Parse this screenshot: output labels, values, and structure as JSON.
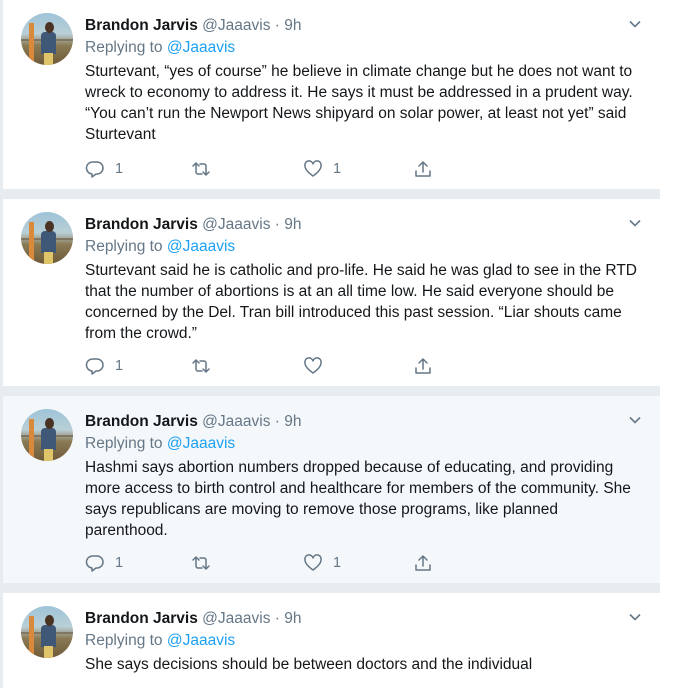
{
  "colors": {
    "background": "#e6ecf0",
    "accent": "#1da1f2",
    "muted": "#657786",
    "text": "#14171a"
  },
  "icons": {
    "reply": "reply-icon",
    "retweet": "retweet-icon",
    "like": "like-icon",
    "share": "share-icon",
    "menu": "chevron-down-icon"
  },
  "tweets": [
    {
      "author": "Brandon Jarvis",
      "handle": "@Jaaavis",
      "time": "· 9h",
      "replying_prefix": "Replying to",
      "replying_to": "@Jaaavis",
      "text": "Sturtevant, “yes of course” he believe in climate change but he does not want to wreck to economy to address it. He says it must be addressed in a prudent way. “You can’t run the Newport News shipyard on solar power, at least not yet” said Sturtevant",
      "reply_count": "1",
      "retweet_count": "",
      "like_count": "1"
    },
    {
      "author": "Brandon Jarvis",
      "handle": "@Jaaavis",
      "time": "· 9h",
      "replying_prefix": "Replying to",
      "replying_to": "@Jaaavis",
      "text": "Sturtevant said he is catholic and pro-life. He said he was glad to see in the RTD that the number of abortions is at an all time low. He said everyone should be concerned by the Del. Tran bill introduced this past session. “Liar shouts came from the crowd.”",
      "reply_count": "1",
      "retweet_count": "",
      "like_count": ""
    },
    {
      "author": "Brandon Jarvis",
      "handle": "@Jaaavis",
      "time": "· 9h",
      "replying_prefix": "Replying to",
      "replying_to": "@Jaaavis",
      "text": "Hashmi says abortion numbers dropped because of educating, and providing more access to birth control and healthcare for members of the community. She says republicans are moving to remove those programs, like planned parenthood.",
      "reply_count": "1",
      "retweet_count": "",
      "like_count": "1"
    },
    {
      "author": "Brandon Jarvis",
      "handle": "@Jaaavis",
      "time": "· 9h",
      "replying_prefix": "Replying to",
      "replying_to": "@Jaaavis",
      "text": "She says decisions should be between doctors and the individual"
    }
  ]
}
